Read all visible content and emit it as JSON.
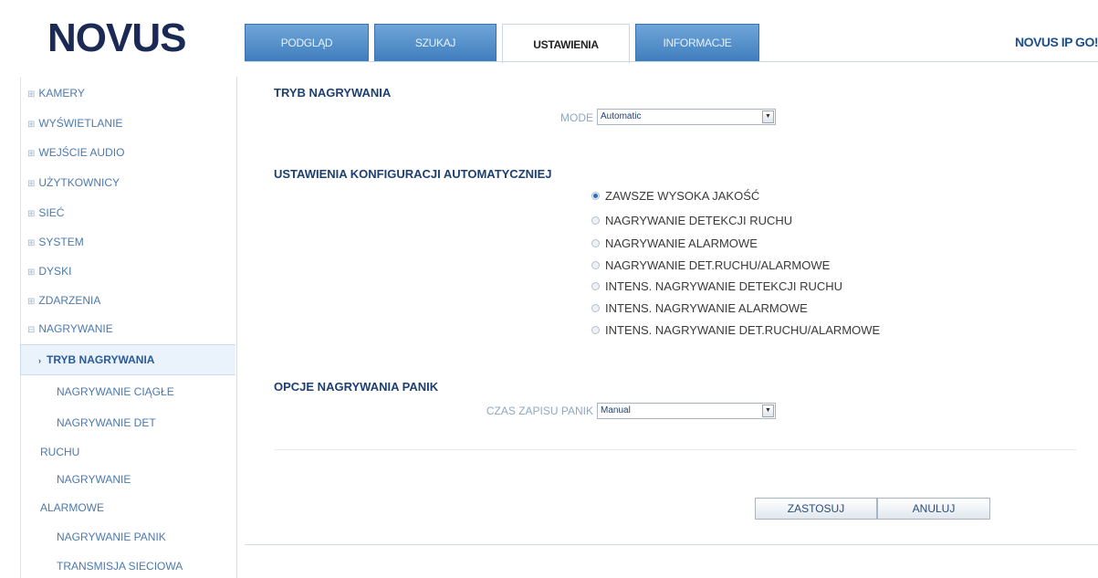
{
  "header": {
    "logo": "NOVUS",
    "product": "NOVUS IP GO!",
    "tabs": [
      {
        "label": "PODGLĄD"
      },
      {
        "label": "SZUKAJ"
      },
      {
        "label": "USTAWIENIA",
        "active": true
      },
      {
        "label": "INFORMACJE"
      }
    ]
  },
  "sidebar": {
    "items": [
      {
        "label": "KAMERY"
      },
      {
        "label": "WYŚWIETLANIE"
      },
      {
        "label": "WEJŚCIE AUDIO"
      },
      {
        "label": "UŻYTKOWNICY"
      },
      {
        "label": "SIEĆ"
      },
      {
        "label": "SYSTEM"
      },
      {
        "label": "DYSKI"
      },
      {
        "label": "ZDARZENIA"
      },
      {
        "label": "NAGRYWANIE"
      }
    ],
    "subitems": [
      {
        "label": "TRYB NAGRYWANIA",
        "active": true
      },
      {
        "label": "NAGRYWANIE CIĄGŁE"
      },
      {
        "label": "NAGRYWANIE DET"
      },
      {
        "label": "RUCHU"
      },
      {
        "label": "NAGRYWANIE"
      },
      {
        "label": "ALARMOWE"
      },
      {
        "label": "NAGRYWANIE PANIK"
      },
      {
        "label": "TRANSMISJA SIECIOWA"
      }
    ]
  },
  "main": {
    "section1_title": "TRYB NAGRYWANIA",
    "mode_label": "MODE",
    "mode_value": "Automatic",
    "section2_title": "USTAWIENIA KONFIGURACJI AUTOMATYCZNIEJ",
    "radio_options": [
      {
        "label": "ZAWSZE WYSOKA JAKOŚĆ",
        "checked": true
      },
      {
        "label": "NAGRYWANIE DETEKCJI RUCHU"
      },
      {
        "label": "NAGRYWANIE ALARMOWE"
      },
      {
        "label": "NAGRYWANIE DET.RUCHU/ALARMOWE"
      },
      {
        "label": "INTENS. NAGRYWANIE DETEKCJI RUCHU"
      },
      {
        "label": "INTENS. NAGRYWANIE ALARMOWE"
      },
      {
        "label": "INTENS. NAGRYWANIE DET.RUCHU/ALARMOWE"
      }
    ],
    "section3_title": "OPCJE NAGRYWANIA PANIK",
    "panic_label": "CZAS ZAPISU PANIK",
    "panic_value": "Manual",
    "apply_label": "ZASTOSUJ",
    "cancel_label": "ANULUJ"
  }
}
